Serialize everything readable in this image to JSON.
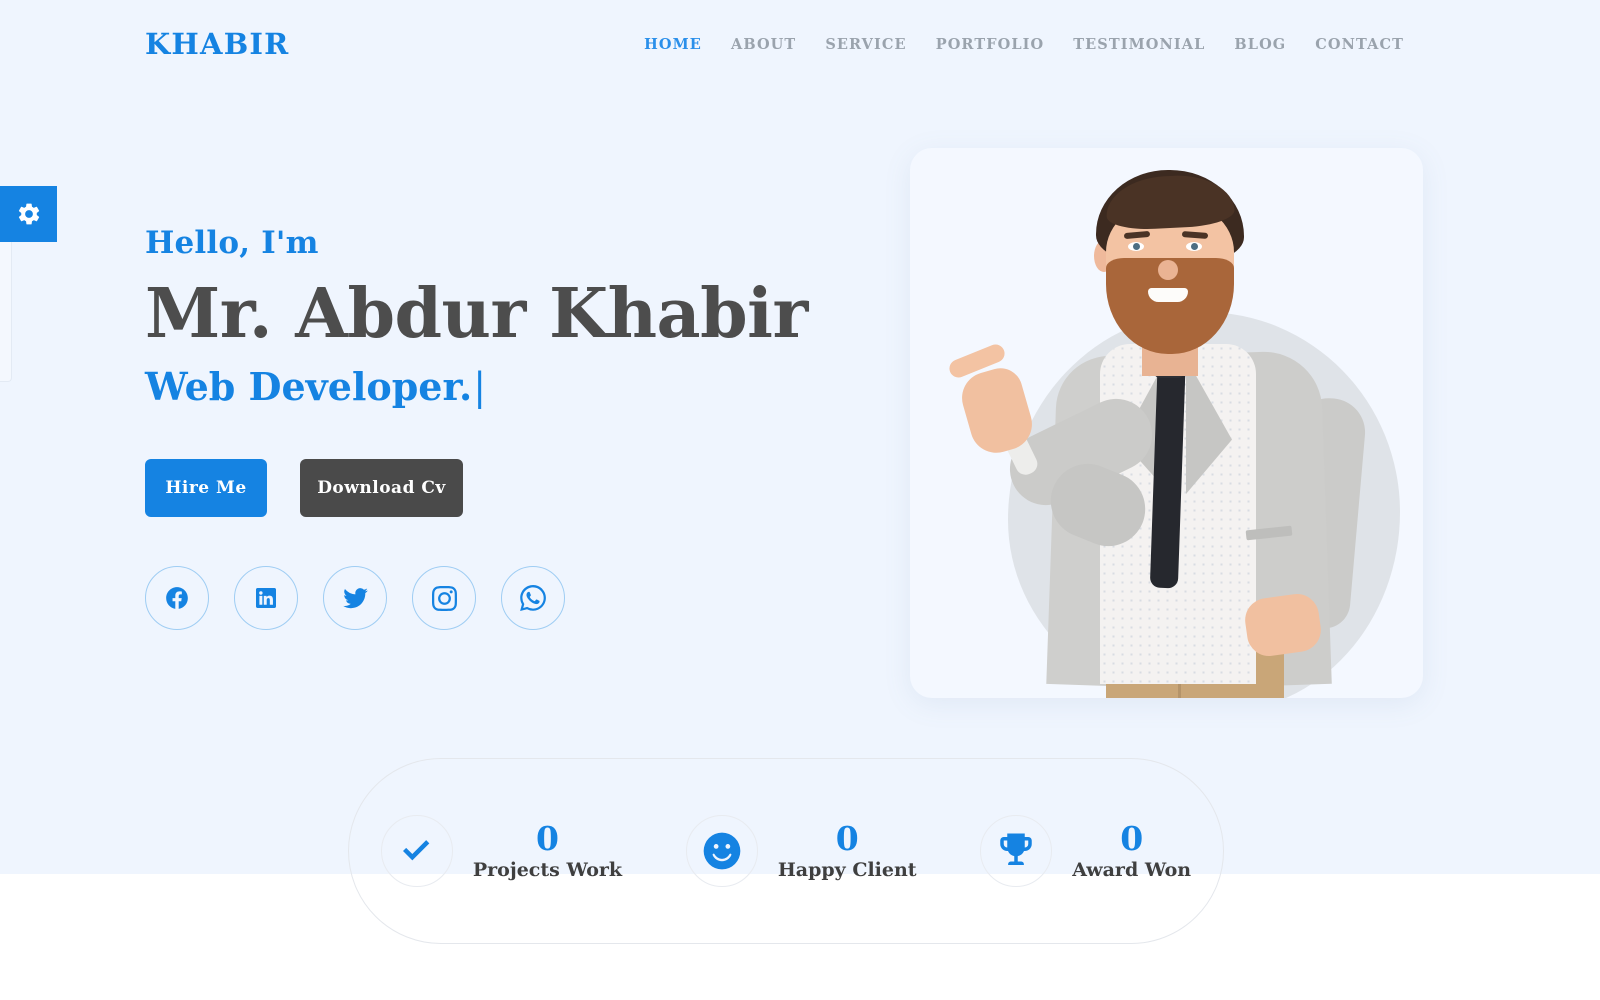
{
  "colors": {
    "accent": "#1583e2",
    "nav_active": "#2a8fea",
    "nav_inactive": "#9aa3ad",
    "heading_dark": "#4d4d4d",
    "dark_button": "#4a4a4a",
    "hero_background": "#eff5fe",
    "card_background": "#f4f8ff",
    "page_background": "#ffffff",
    "blob": "#dfe3e8",
    "stats_border": "#e4e7ec"
  },
  "header": {
    "brand": "KHABIR",
    "nav": [
      {
        "label": "HOME",
        "active": true
      },
      {
        "label": "ABOUT",
        "active": false
      },
      {
        "label": "SERVICE",
        "active": false
      },
      {
        "label": "PORTFOLIO",
        "active": false
      },
      {
        "label": "TESTIMONIAL",
        "active": false
      },
      {
        "label": "BLOG",
        "active": false
      },
      {
        "label": "CONTACT",
        "active": false
      }
    ]
  },
  "settings": {
    "icon": "gear-icon"
  },
  "hero": {
    "greeting": "Hello, I'm",
    "name": "Mr. Abdur Khabir",
    "role": "Web Developer.",
    "typed_cursor": "|",
    "buttons": {
      "primary": "Hire Me",
      "secondary": "Download Cv"
    },
    "socials": [
      {
        "name": "facebook-icon",
        "label": "Facebook"
      },
      {
        "name": "linkedin-icon",
        "label": "LinkedIn"
      },
      {
        "name": "twitter-icon",
        "label": "Twitter"
      },
      {
        "name": "instagram-icon",
        "label": "Instagram"
      },
      {
        "name": "whatsapp-icon",
        "label": "WhatsApp"
      }
    ],
    "portrait_alt": "Bearded man in grey blazer pointing left"
  },
  "stats": [
    {
      "icon": "check-icon",
      "count": "0",
      "label": "Projects Work"
    },
    {
      "icon": "smiley-icon",
      "count": "0",
      "label": "Happy Client"
    },
    {
      "icon": "trophy-icon",
      "count": "0",
      "label": "Award Won"
    }
  ]
}
